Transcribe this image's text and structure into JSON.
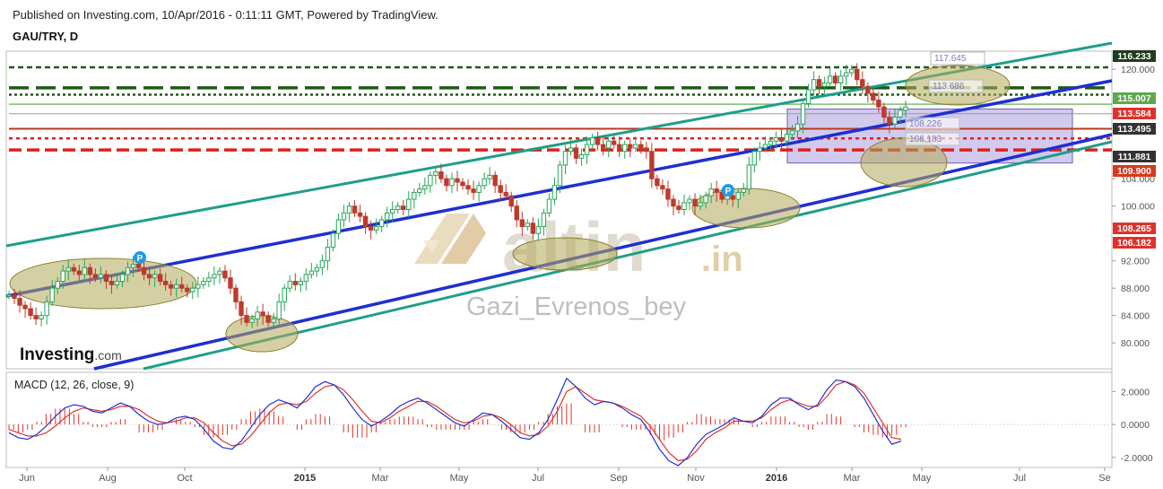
{
  "header": {
    "published": "Published on Investing.com, 10/Apr/2016 - 0:11:11 GMT, Powered by TradingView.",
    "symbol": "GAU/TRY, D"
  },
  "watermark": {
    "brand": "altin",
    "brand_tld": ".in",
    "author": "Gazi_Evrenos_bey",
    "logo": "Investing",
    "logo_suffix": ".com"
  },
  "macd": {
    "label": "MACD (12, 26, close, 9)"
  },
  "chart_data": [
    {
      "type": "line",
      "panel": "price",
      "y_ticks": [
        "120.000",
        "104.000",
        "100.000",
        "92.000",
        "88.000",
        "84.000",
        "80.000"
      ],
      "ylim": [
        77.0,
        122.0
      ],
      "x_ticks": [
        "Jun",
        "Aug",
        "Oct",
        "2015",
        "Mar",
        "May",
        "Jul",
        "Sep",
        "Nov",
        "2016",
        "Mar",
        "May",
        "Jul",
        "Se"
      ],
      "x_ticks_bold": [
        "2015",
        "2016"
      ],
      "price_badges": [
        {
          "label": "116.233",
          "color": "#1e3d1e"
        },
        {
          "label": "115.007",
          "color": "#5fa84c"
        },
        {
          "label": "113.584",
          "color": "#e0322b"
        },
        {
          "label": "113.495",
          "color": "#333333"
        },
        {
          "label": "111.881",
          "color": "#333333"
        },
        {
          "label": "109.900",
          "color": "#d43a1e"
        },
        {
          "label": "108.265",
          "color": "#e0322b"
        },
        {
          "label": "106.182",
          "color": "#e0322b"
        }
      ],
      "fib_labels": [
        "117.645",
        "113.686",
        "108.226",
        "106.183"
      ],
      "markers": [
        "P",
        "P"
      ],
      "series": [
        {
          "values": [
            87,
            86.5,
            85.5,
            85,
            84,
            83.5,
            84,
            86,
            88,
            89,
            90.5,
            91,
            90.5,
            90,
            91,
            90,
            89.5,
            90,
            89,
            88.5,
            89,
            90,
            91,
            91.5,
            91,
            90,
            89.5,
            90,
            89,
            88.5,
            88,
            88.5,
            88,
            87.5,
            88,
            88.5,
            89,
            89.5,
            90,
            90.5,
            89.5,
            88,
            86,
            84,
            83,
            83.5,
            84.5,
            84,
            83,
            83.5,
            86,
            88,
            89,
            88.5,
            89,
            90,
            90.5,
            91,
            92,
            94,
            96,
            98,
            99,
            100,
            99,
            98.5,
            97,
            96.5,
            97,
            98,
            99,
            99.5,
            100,
            99.5,
            101,
            102,
            102.5,
            103,
            104.5,
            105,
            104,
            103,
            104,
            103.5,
            103,
            102.5,
            102,
            103,
            104,
            104.5,
            103,
            102,
            101.5,
            100,
            98,
            97,
            97.5,
            96,
            97,
            99,
            101,
            103,
            106,
            108,
            108.5,
            107,
            107.5,
            109,
            110,
            109,
            108.5,
            109.5,
            109,
            108,
            109,
            108.5,
            109,
            108.5,
            108,
            104,
            103,
            102.5,
            101,
            100,
            99.5,
            100.5,
            101,
            100,
            100.5,
            101.5,
            102.5,
            102,
            101,
            101.5,
            101,
            102,
            102.5,
            106,
            108,
            108.5,
            109,
            109.5,
            110,
            109.5,
            110.5,
            111,
            112,
            115,
            117,
            118.5,
            117.5,
            118,
            119,
            118,
            119,
            119.5,
            120,
            118.5,
            117.5,
            116.5,
            115.5,
            114.5,
            113,
            112,
            113,
            114,
            114.5
          ]
        }
      ]
    },
    {
      "type": "line",
      "panel": "macd",
      "title": "MACD (12, 26, close, 9)",
      "y_ticks": [
        "2.0000",
        "0.0000",
        "-2.0000"
      ],
      "ylim": [
        -2.5,
        3.0
      ],
      "series": [
        {
          "values": [
            -0.5,
            -0.8,
            -0.9,
            -0.6,
            -0.1,
            0.5,
            1.0,
            1.2,
            1.1,
            0.8,
            0.7,
            1.0,
            1.3,
            1.1,
            0.6,
            0.2,
            0.0,
            0.1,
            0.4,
            0.5,
            0.3,
            -0.3,
            -1.0,
            -1.4,
            -1.5,
            -1.0,
            -0.2,
            0.6,
            1.2,
            1.5,
            1.3,
            1.0,
            1.6,
            2.3,
            2.6,
            2.4,
            1.8,
            1.0,
            0.3,
            -0.1,
            0.2,
            0.6,
            1.1,
            1.4,
            1.6,
            1.3,
            0.9,
            0.5,
            0.1,
            -0.1,
            0.3,
            0.7,
            0.6,
            0.2,
            -0.3,
            -0.8,
            -0.9,
            -0.5,
            0.3,
            1.5,
            2.8,
            2.3,
            1.6,
            1.2,
            1.4,
            1.3,
            1.0,
            0.6,
            0.3,
            -0.5,
            -1.5,
            -2.2,
            -2.5,
            -2.0,
            -1.2,
            -0.6,
            -0.3,
            0.0,
            0.4,
            0.2,
            0.1,
            0.5,
            1.2,
            1.6,
            1.6,
            1.2,
            0.9,
            1.2,
            2.1,
            2.7,
            2.6,
            2.3,
            1.6,
            0.6,
            -0.4,
            -1.2,
            -1.0
          ]
        },
        {
          "values": [
            -0.3,
            -0.5,
            -0.7,
            -0.7,
            -0.5,
            -0.1,
            0.4,
            0.8,
            1.0,
            0.9,
            0.8,
            0.9,
            1.1,
            1.1,
            0.9,
            0.5,
            0.2,
            0.1,
            0.2,
            0.4,
            0.4,
            0.1,
            -0.5,
            -1.0,
            -1.3,
            -1.2,
            -0.7,
            0.0,
            0.7,
            1.2,
            1.3,
            1.2,
            1.4,
            1.9,
            2.3,
            2.4,
            2.1,
            1.5,
            0.8,
            0.2,
            0.1,
            0.4,
            0.8,
            1.1,
            1.4,
            1.4,
            1.1,
            0.7,
            0.3,
            0.1,
            0.2,
            0.5,
            0.6,
            0.4,
            0.0,
            -0.5,
            -0.7,
            -0.6,
            -0.1,
            0.8,
            2.0,
            2.3,
            1.9,
            1.5,
            1.4,
            1.3,
            1.1,
            0.8,
            0.5,
            -0.1,
            -0.9,
            -1.7,
            -2.2,
            -2.1,
            -1.6,
            -0.9,
            -0.5,
            -0.2,
            0.2,
            0.2,
            0.2,
            0.4,
            0.9,
            1.3,
            1.5,
            1.3,
            1.1,
            1.1,
            1.7,
            2.4,
            2.6,
            2.4,
            1.9,
            1.0,
            0.1,
            -0.8,
            -0.9
          ]
        }
      ]
    }
  ],
  "colors": {
    "candle_up": "#26a65b",
    "candle_down": "#c0392b",
    "channel_blue": "#1f2fd1",
    "channel_teal": "#1f9e8a",
    "resistance_green": "#1e5a14",
    "support_red": "#e0201a",
    "zone_fill": "#b3a95a",
    "box_fill": "#9b8ad6",
    "macd_line": "#2233cc",
    "signal_line": "#e0342b"
  }
}
